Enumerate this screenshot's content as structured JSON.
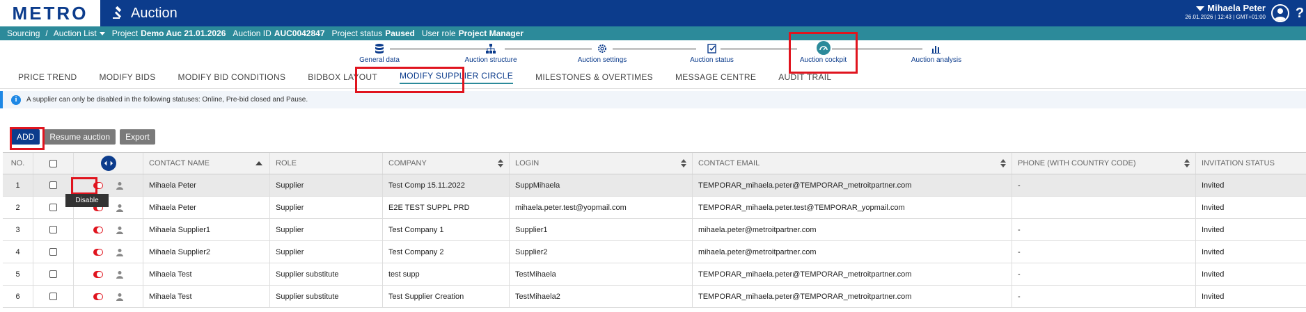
{
  "header": {
    "logo_text": "METRO",
    "app_title": "Auction",
    "user_name": "Mihaela Peter",
    "user_meta": "26.01.2026 | 12:43 | GMT+01:00",
    "help_label": "?"
  },
  "infobar": {
    "sourcing": "Sourcing",
    "separator": "/",
    "auction_list": "Auction List",
    "project_label": "Project",
    "project_value": "Demo Auc 21.01.2026",
    "auction_id_label": "Auction ID",
    "auction_id_value": "AUC0042847",
    "status_label": "Project status",
    "status_value": "Paused",
    "role_label": "User role",
    "role_value": "Project Manager"
  },
  "stepper": {
    "steps": [
      {
        "label": "General data",
        "icon": "database-icon"
      },
      {
        "label": "Auction structure",
        "icon": "hierarchy-icon"
      },
      {
        "label": "Auction settings",
        "icon": "gear-icon"
      },
      {
        "label": "Auction status",
        "icon": "checklist-icon"
      },
      {
        "label": "Auction cockpit",
        "icon": "gauge-icon",
        "active": true
      },
      {
        "label": "Auction analysis",
        "icon": "bar-chart-icon"
      }
    ]
  },
  "tabs": [
    {
      "label": "PRICE TREND"
    },
    {
      "label": "MODIFY BIDS"
    },
    {
      "label": "MODIFY BID CONDITIONS"
    },
    {
      "label": "BIDBOX LAYOUT"
    },
    {
      "label": "MODIFY SUPPLIER CIRCLE",
      "active": true
    },
    {
      "label": "MILESTONES & OVERTIMES"
    },
    {
      "label": "MESSAGE CENTRE"
    },
    {
      "label": "AUDIT TRAIL"
    }
  ],
  "notice": {
    "icon_letter": "i",
    "text": "A supplier can only be disabled in the following statuses: Online, Pre-bid closed and Pause."
  },
  "buttons": {
    "add": "ADD",
    "resume": "Resume auction",
    "export": "Export"
  },
  "table": {
    "columns": {
      "no": "NO.",
      "contact_name": "CONTACT NAME",
      "role": "ROLE",
      "company": "COMPANY",
      "login": "LOGIN",
      "contact_email": "CONTACT EMAIL",
      "phone": "PHONE (WITH COUNTRY CODE)",
      "invitation_status": "INVITATION STATUS"
    },
    "rows": [
      {
        "no": "1",
        "name": "Mihaela Peter",
        "role": "Supplier",
        "company": "Test Comp 15.11.2022",
        "login": "SuppMihaela",
        "email": "TEMPORAR_mihaela.peter@TEMPORAR_metroitpartner.com",
        "phone": "-",
        "status": "Invited"
      },
      {
        "no": "2",
        "name": "Mihaela Peter",
        "role": "Supplier",
        "company": "E2E TEST SUPPL PRD",
        "login": "mihaela.peter.test@yopmail.com",
        "email": "TEMPORAR_mihaela.peter.test@TEMPORAR_yopmail.com",
        "phone": "",
        "status": "Invited"
      },
      {
        "no": "3",
        "name": "Mihaela Supplier1",
        "role": "Supplier",
        "company": "Test Company 1",
        "login": "Supplier1",
        "email": "mihaela.peter@metroitpartner.com",
        "phone": "-",
        "status": "Invited"
      },
      {
        "no": "4",
        "name": "Mihaela Supplier2",
        "role": "Supplier",
        "company": "Test Company 2",
        "login": "Supplier2",
        "email": "mihaela.peter@metroitpartner.com",
        "phone": "-",
        "status": "Invited"
      },
      {
        "no": "5",
        "name": "Mihaela Test",
        "role": "Supplier substitute",
        "company": "test supp",
        "login": "TestMihaela",
        "email": "TEMPORAR_mihaela.peter@TEMPORAR_metroitpartner.com",
        "phone": "-",
        "status": "Invited"
      },
      {
        "no": "6",
        "name": "Mihaela Test",
        "role": "Supplier substitute",
        "company": "Test Supplier Creation",
        "login": "TestMihaela2",
        "email": "TEMPORAR_mihaela.peter@TEMPORAR_metroitpartner.com",
        "phone": "-",
        "status": "Invited"
      }
    ]
  },
  "tooltip": {
    "text": "Disable"
  },
  "colors": {
    "brand": "#0c3c8c",
    "teal": "#2c8a9a",
    "highlight": "#e0141e"
  }
}
